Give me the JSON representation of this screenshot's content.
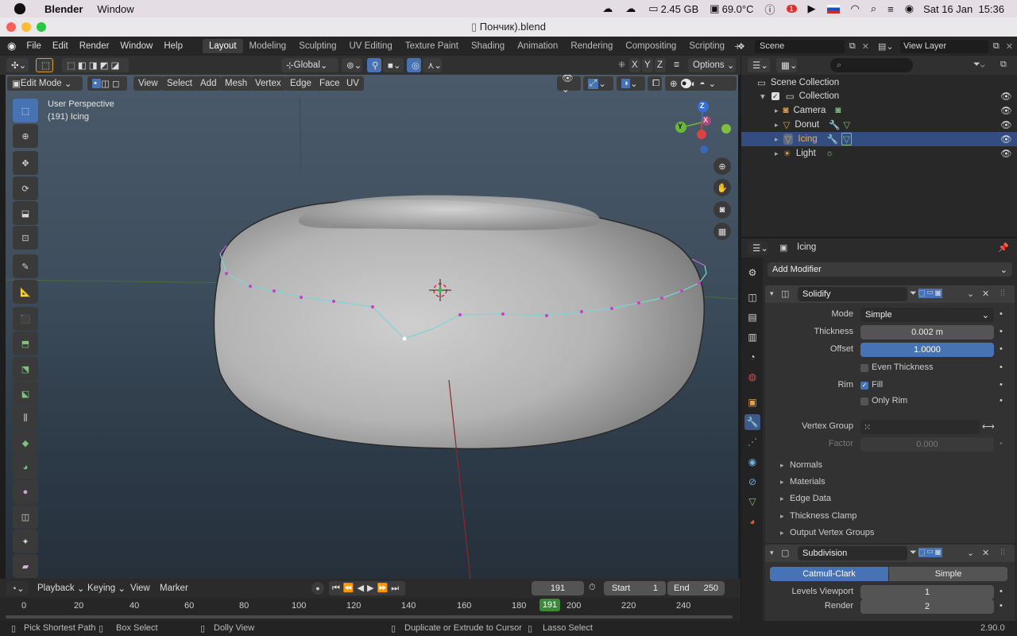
{
  "mac_bar": {
    "app": "Blender",
    "menu": "Window",
    "memory": "2.45 GB",
    "temp": "69.0°C",
    "notification_count": "1",
    "datetime": "Sat 16 Jan  15:36"
  },
  "window": {
    "title": "Пончик).blend"
  },
  "menus": [
    "File",
    "Edit",
    "Render",
    "Window",
    "Help"
  ],
  "workspaces": [
    "Layout",
    "Modeling",
    "Sculpting",
    "UV Editing",
    "Texture Paint",
    "Shading",
    "Animation",
    "Rendering",
    "Compositing",
    "Scripting"
  ],
  "scene": {
    "label": "Scene",
    "view_layer": "View Layer"
  },
  "header": {
    "orientation": "Global",
    "options": "Options",
    "axes": [
      "X",
      "Y",
      "Z"
    ]
  },
  "viewport_header": {
    "mode": "Edit Mode",
    "menus": [
      "View",
      "Select",
      "Add",
      "Mesh",
      "Vertex",
      "Edge",
      "Face",
      "UV"
    ]
  },
  "viewport": {
    "perspective": "User Perspective",
    "object_info": "(191) Icing",
    "gizmo": {
      "z": "Z",
      "y": "Y",
      "x": "X"
    }
  },
  "outliner": {
    "root": "Scene Collection",
    "collection": "Collection",
    "items": [
      {
        "name": "Camera",
        "selected": false
      },
      {
        "name": "Donut",
        "selected": false
      },
      {
        "name": "Icing",
        "selected": true
      },
      {
        "name": "Light",
        "selected": false
      }
    ]
  },
  "properties": {
    "object_name": "Icing",
    "add_modifier": "Add Modifier",
    "solidify": {
      "name": "Solidify",
      "mode_label": "Mode",
      "mode": "Simple",
      "thickness_label": "Thickness",
      "thickness": "0.002 m",
      "offset_label": "Offset",
      "offset": "1.0000",
      "even_thickness": "Even Thickness",
      "rim_label": "Rim",
      "fill": "Fill",
      "only_rim": "Only Rim",
      "vertex_group_label": "Vertex Group",
      "factor_label": "Factor",
      "factor": "0.000",
      "subpanels": [
        "Normals",
        "Materials",
        "Edge Data",
        "Thickness Clamp",
        "Output Vertex Groups"
      ]
    },
    "subdivision": {
      "name": "Subdivision",
      "tab_catmull": "Catmull-Clark",
      "tab_simple": "Simple",
      "levels_viewport_label": "Levels Viewport",
      "levels_viewport": "1",
      "render_label": "Render",
      "render": "2"
    }
  },
  "timeline": {
    "menus": [
      "Playback",
      "Keying",
      "View",
      "Marker"
    ],
    "current_frame": "191",
    "start_label": "Start",
    "start": "1",
    "end_label": "End",
    "end": "250",
    "ruler": [
      "0",
      "20",
      "40",
      "60",
      "80",
      "100",
      "120",
      "140",
      "160",
      "180",
      "200",
      "220",
      "240"
    ]
  },
  "status_bar": {
    "items": [
      "Pick Shortest Path",
      "Box Select",
      "Dolly View",
      "Duplicate or Extrude to Cursor",
      "Lasso Select"
    ],
    "version": "2.90.0"
  }
}
